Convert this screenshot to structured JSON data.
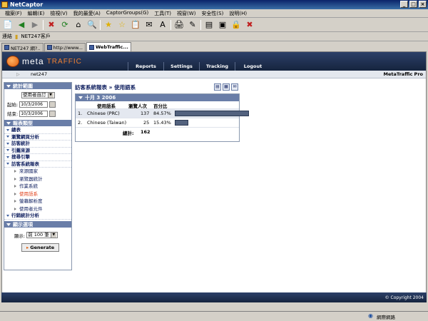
{
  "window": {
    "title": "NetCaptor"
  },
  "menu": [
    "檔案(F)",
    "編輯(E)",
    "檢視(V)",
    "我的最愛(A)",
    "CaptorGroups(G)",
    "工具(T)",
    "視窗(W)",
    "安全性(S)",
    "說明(H)"
  ],
  "address": {
    "label": "連結",
    "link": "NET247客戶"
  },
  "tabs": [
    "NET247 網?..",
    "http://www...",
    "WebTraffic..."
  ],
  "app": {
    "logo_meta": "meta",
    "logo_traffic": "TRAFFIC",
    "nav": [
      "Reports",
      "Settings",
      "Tracking",
      "Logout"
    ],
    "account": "net247",
    "product": "MetaTraffic Pro",
    "footer": "© Copyright 2004"
  },
  "sidebar": {
    "range_header": "統計範圍",
    "range_select": "使用者自訂",
    "start_label": "起始:",
    "start_value": "10/3/2006",
    "end_label": "結束:",
    "end_value": "10/3/2006",
    "report_header": "報表類型",
    "items": [
      "總表",
      "瀏覽網頁分析",
      "訪客統計",
      "引薦來源",
      "搜尋引擎",
      "訪客系統報表"
    ],
    "subitems": [
      "來源國家",
      "瀏覽器統計",
      "作業系統",
      "使用語系",
      "螢幕解析度",
      "使用者元件"
    ],
    "active_subitem": "使用語系",
    "last_item": "行銷統計分析",
    "display_header": "顯示選項",
    "display_label": "顯示:",
    "display_select": "前 100 筆",
    "generate": "Generate"
  },
  "content": {
    "title": "訪客系統報表 » 使用語系",
    "date": "十月 3 2006",
    "col_lang": "使用語系",
    "col_visitors": "瀏覽人次",
    "col_percent": "百分比",
    "rows": [
      {
        "rank": "1.",
        "lang": "Chinese (PRC)",
        "visitors": "137",
        "percent": "84.57%",
        "fraction": 0.8457
      },
      {
        "rank": "2.",
        "lang": "Chinese (Taiwan)",
        "visitors": "25",
        "percent": "15.43%",
        "fraction": 0.1543
      }
    ],
    "total_label": "總計:",
    "total_value": "162"
  },
  "statusbar": {
    "zone": "網際網路"
  }
}
